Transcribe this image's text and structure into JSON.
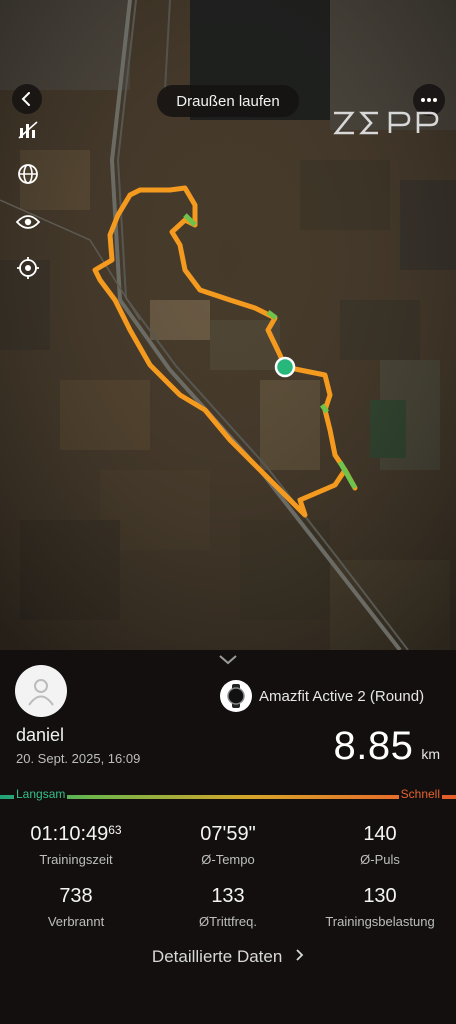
{
  "map": {
    "title": "Draußen laufen",
    "logo_text": "ZEPP",
    "icons": [
      "back-icon",
      "more-icon",
      "heatmap-icon",
      "globe-icon",
      "eye-icon",
      "locate-icon"
    ],
    "route_color": "#f39a1f",
    "route_highlight_color": "#6fc24a",
    "start_marker_color": "#27b77a"
  },
  "summary": {
    "username": "daniel",
    "datetime": "20. Sept. 2025, 16:09",
    "device": "Amazfit Active 2 (Round)",
    "distance_value": "8.85",
    "distance_unit": "km",
    "pace_slow_label": "Langsam",
    "pace_fast_label": "Schnell"
  },
  "stats": [
    {
      "value": "01:10:49",
      "fraction": "63",
      "label": "Trainingszeit"
    },
    {
      "value": "07'59\"",
      "label": "Ø-Tempo"
    },
    {
      "value": "140",
      "label": "Ø-Puls"
    },
    {
      "value": "738",
      "label": "Verbrannt"
    },
    {
      "value": "133",
      "label": "ØTrittfreq."
    },
    {
      "value": "130",
      "label": "Trainingsbelastung"
    }
  ],
  "details_link": "Detaillierte Daten"
}
